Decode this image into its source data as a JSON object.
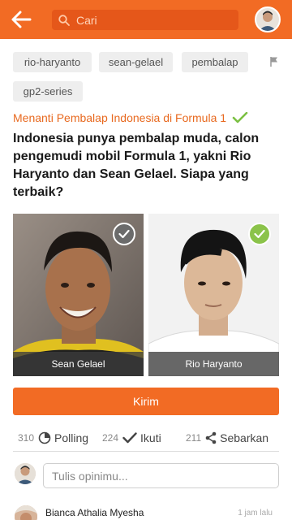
{
  "header": {
    "search_placeholder": "Cari",
    "icons": [
      "back-arrow-icon",
      "search-icon",
      "user-avatar"
    ],
    "accent_color": "#f26b24"
  },
  "tags": [
    "rio-haryanto",
    "sean-gelael",
    "pembalap",
    "gp2-series"
  ],
  "poll": {
    "title": "Menanti Pembalap Indonesia di Formula 1",
    "question": "Indonesia punya pembalap muda, calon pengemudi mobil Formula 1, yakni Rio Haryanto dan Sean Gelael. Siapa yang terbaik?",
    "choices": [
      {
        "name": "Sean Gelael",
        "selected": false
      },
      {
        "name": "Rio Haryanto",
        "selected": true
      }
    ],
    "submit_label": "Kirim"
  },
  "stats": {
    "polling_count": "310",
    "polling_label": "Polling",
    "follow_count": "224",
    "follow_label": "Ikuti",
    "share_count": "211",
    "share_label": "Sebarkan"
  },
  "comment": {
    "placeholder": "Tulis opinimu..."
  },
  "latest_comment": {
    "author": "Bianca Athalia Myesha",
    "time": "1 jam lalu"
  }
}
